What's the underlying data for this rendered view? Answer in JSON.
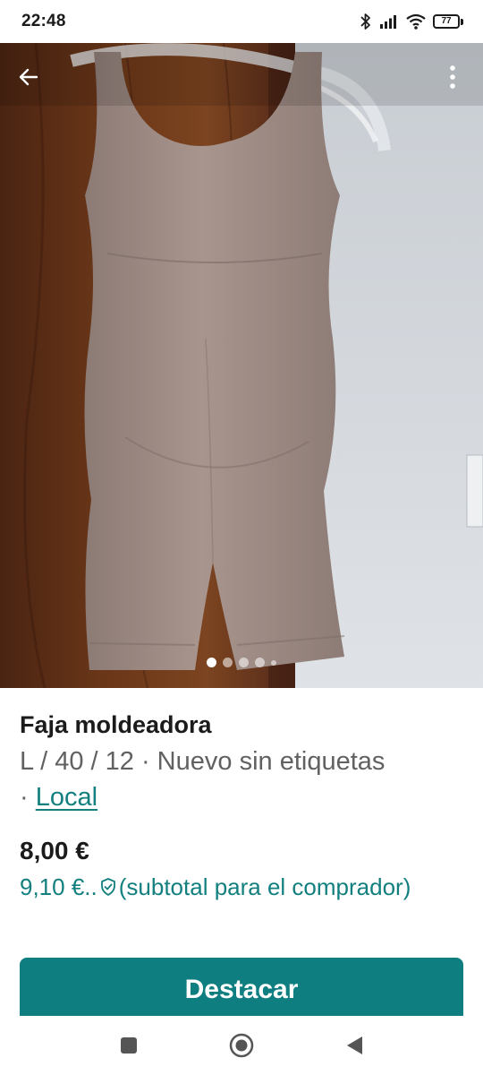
{
  "status_bar": {
    "time": "22:48",
    "battery": "77",
    "icons": [
      "bluetooth-icon",
      "signal-icon",
      "wifi-icon",
      "battery-icon"
    ]
  },
  "photo": {
    "image_count": 5,
    "active_index": 0
  },
  "listing": {
    "title": "Faja moldeadora",
    "attributes": "L / 40 / 12 · Nuevo sin etiquetas",
    "attributes_sep": "·",
    "local_label": "Local",
    "price": "8,00 €",
    "buyer_price": "9,10 €",
    "buyer_ellipsis": "..",
    "buyer_note": "(subtotal para el comprador)"
  },
  "actions": {
    "highlight_label": "Destacar"
  },
  "colors": {
    "accent": "#0f7e80",
    "link": "#13807f",
    "text": "#1b1b1b",
    "muted": "#616161"
  }
}
